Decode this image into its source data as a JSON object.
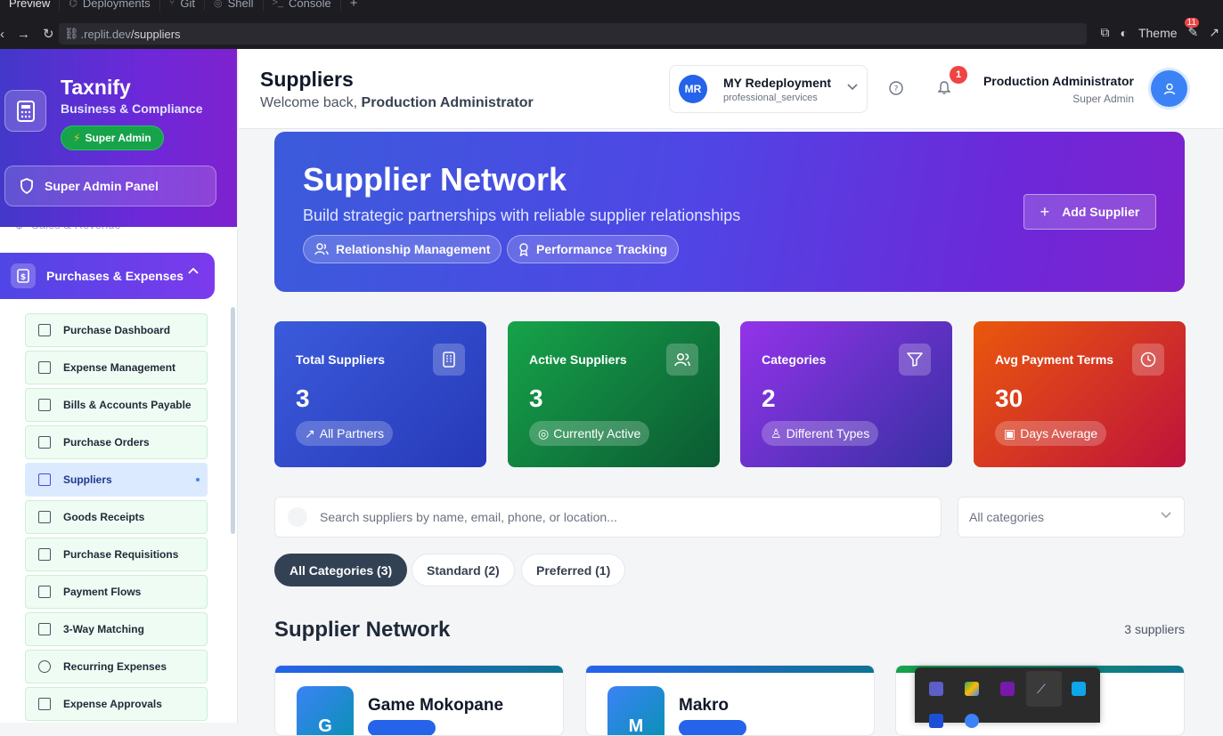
{
  "browser": {
    "tabs": [
      {
        "label": "Preview",
        "icon": "preview-icon"
      },
      {
        "label": "Deployments",
        "icon": "deploy-icon"
      },
      {
        "label": "Git",
        "icon": "git-icon"
      },
      {
        "label": "Shell",
        "icon": "shell-icon"
      },
      {
        "label": "Console",
        "icon": "console-icon"
      }
    ],
    "plus": "+",
    "url_host": ".replit.dev",
    "url_path": "/suppliers",
    "theme_label": "Theme",
    "notif_count": "11"
  },
  "sidebar": {
    "brand": "Taxnify",
    "subtitle": "Business & Compliance",
    "badge": "Super Admin",
    "panel_button": "Super Admin Panel",
    "partial_item": "Sales & Revenue",
    "group_label": "Purchases & Expenses",
    "items": [
      {
        "label": "Purchase Dashboard"
      },
      {
        "label": "Expense Management"
      },
      {
        "label": "Bills & Accounts Payable"
      },
      {
        "label": "Purchase Orders"
      },
      {
        "label": "Suppliers"
      },
      {
        "label": "Goods Receipts"
      },
      {
        "label": "Purchase Requisitions"
      },
      {
        "label": "Payment Flows"
      },
      {
        "label": "3-Way Matching"
      },
      {
        "label": "Recurring Expenses"
      },
      {
        "label": "Expense Approvals"
      }
    ]
  },
  "header": {
    "title": "Suppliers",
    "welcome_prefix": "Welcome back, ",
    "welcome_name": "Production Administrator",
    "org_initials": "MR",
    "org_name": "MY Redeployment",
    "org_type": "professional_services",
    "notification_count": "1",
    "user_name": "Production Administrator",
    "user_role": "Super Admin"
  },
  "hero": {
    "title": "Supplier Network",
    "subtitle": "Build strategic partnerships with reliable supplier relationships",
    "pill1": "Relationship Management",
    "pill2": "Performance Tracking",
    "add_button": "Add Supplier"
  },
  "stats": [
    {
      "label": "Total Suppliers",
      "value": "3",
      "badge": "All Partners",
      "icon": "building-icon"
    },
    {
      "label": "Active Suppliers",
      "value": "3",
      "badge": "Currently Active",
      "icon": "users-icon"
    },
    {
      "label": "Categories",
      "value": "2",
      "badge": "Different Types",
      "icon": "filter-icon"
    },
    {
      "label": "Avg Payment Terms",
      "value": "30",
      "badge": "Days Average",
      "icon": "clock-icon"
    }
  ],
  "search": {
    "placeholder": "Search suppliers by name, email, phone, or location...",
    "category_select": "All categories"
  },
  "filters": [
    "All Categories (3)",
    "Standard (2)",
    "Preferred (1)"
  ],
  "section": {
    "title": "Supplier Network",
    "count": "3 suppliers"
  },
  "cards": [
    {
      "initial": "G",
      "name": "Game Mokopane"
    },
    {
      "initial": "M",
      "name": "Makro"
    }
  ],
  "colors": {
    "accent": "#4f46e5",
    "stat_blue": "#2f4fd6",
    "stat_green": "#16a34a",
    "stat_purple": "#9333ea",
    "stat_red": "#dc2626"
  }
}
